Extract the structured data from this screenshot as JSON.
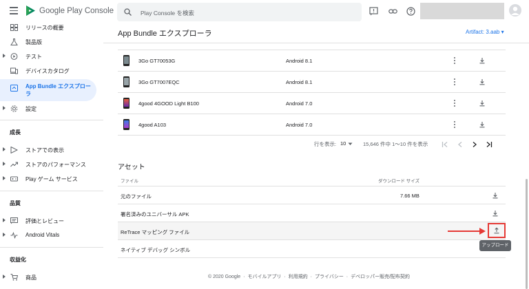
{
  "app": {
    "brand": "Google Play Console"
  },
  "sidebar": {
    "items": [
      {
        "label": "リリースの概要",
        "icon": "grid-icon"
      },
      {
        "label": "製品版",
        "icon": "flask-icon"
      },
      {
        "label": "テスト",
        "icon": "play-circle-icon"
      },
      {
        "label": "デバイスカタログ",
        "icon": "devices-icon"
      },
      {
        "label": "App Bundle エクスプローラ",
        "icon": "bundle-icon",
        "active": true
      },
      {
        "label": "設定",
        "icon": "gear-icon"
      }
    ],
    "sections": {
      "growth": {
        "title": "成長",
        "items": [
          {
            "label": "ストアでの表示",
            "icon": "play-store-icon"
          },
          {
            "label": "ストアのパフォーマンス",
            "icon": "trending-icon"
          },
          {
            "label": "Play ゲーム サービス",
            "icon": "gamepad-icon"
          }
        ]
      },
      "quality": {
        "title": "品質",
        "items": [
          {
            "label": "評価とレビュー",
            "icon": "reviews-icon"
          },
          {
            "label": "Android Vitals",
            "icon": "vitals-icon"
          }
        ]
      },
      "monetize": {
        "title": "収益化",
        "items": [
          {
            "label": "商品",
            "icon": "cart-icon"
          }
        ]
      }
    }
  },
  "header": {
    "search_placeholder": "Play Console を検索",
    "page_title": "App Bundle エクスプローラ",
    "artifact": "Artifact: 3.aab ▾"
  },
  "devices": [
    {
      "name": "3Go GT70053G",
      "os": "Android 8.1"
    },
    {
      "name": "3Go GT7007EQC",
      "os": "Android 8.1"
    },
    {
      "name": "4good 4GOOD Light B100",
      "os": "Android 7.0"
    },
    {
      "name": "4good A103",
      "os": "Android 7.0"
    }
  ],
  "pager": {
    "rows_label": "行を表示:",
    "rows_value": "10",
    "range": "15,646 件中 1〜10 件を表示"
  },
  "assets": {
    "title": "アセット",
    "col_file": "ファイル",
    "col_size": "ダウンロード サイズ",
    "rows": [
      {
        "name": "元のファイル",
        "size": "7.66 MB",
        "action": "download"
      },
      {
        "name": "署名済みのユニバーサル APK",
        "size": "",
        "action": "download"
      },
      {
        "name": "ReTrace マッピング ファイル",
        "size": "",
        "action": "upload",
        "highlight": true
      },
      {
        "name": "ネイティブ デバッグ シンボル",
        "size": "",
        "action": "none"
      }
    ],
    "upload_tooltip": "アップロード"
  },
  "footer": {
    "copyright": "© 2020 Google",
    "links": [
      "モバイルアプリ",
      "利用規約",
      "プライバシー",
      "デベロッパー販売/配布契約"
    ]
  },
  "colors": {
    "accent": "#1a73e8",
    "active_bg": "#e8f0fe",
    "highlight": "#e53935"
  }
}
